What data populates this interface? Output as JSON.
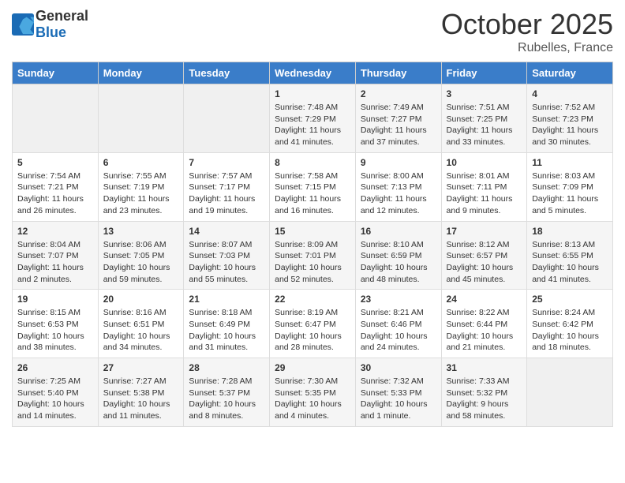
{
  "header": {
    "logo_general": "General",
    "logo_blue": "Blue",
    "month": "October 2025",
    "location": "Rubelles, France"
  },
  "days_of_week": [
    "Sunday",
    "Monday",
    "Tuesday",
    "Wednesday",
    "Thursday",
    "Friday",
    "Saturday"
  ],
  "weeks": [
    [
      {
        "day": "",
        "info": ""
      },
      {
        "day": "",
        "info": ""
      },
      {
        "day": "",
        "info": ""
      },
      {
        "day": "1",
        "info": "Sunrise: 7:48 AM\nSunset: 7:29 PM\nDaylight: 11 hours and 41 minutes."
      },
      {
        "day": "2",
        "info": "Sunrise: 7:49 AM\nSunset: 7:27 PM\nDaylight: 11 hours and 37 minutes."
      },
      {
        "day": "3",
        "info": "Sunrise: 7:51 AM\nSunset: 7:25 PM\nDaylight: 11 hours and 33 minutes."
      },
      {
        "day": "4",
        "info": "Sunrise: 7:52 AM\nSunset: 7:23 PM\nDaylight: 11 hours and 30 minutes."
      }
    ],
    [
      {
        "day": "5",
        "info": "Sunrise: 7:54 AM\nSunset: 7:21 PM\nDaylight: 11 hours and 26 minutes."
      },
      {
        "day": "6",
        "info": "Sunrise: 7:55 AM\nSunset: 7:19 PM\nDaylight: 11 hours and 23 minutes."
      },
      {
        "day": "7",
        "info": "Sunrise: 7:57 AM\nSunset: 7:17 PM\nDaylight: 11 hours and 19 minutes."
      },
      {
        "day": "8",
        "info": "Sunrise: 7:58 AM\nSunset: 7:15 PM\nDaylight: 11 hours and 16 minutes."
      },
      {
        "day": "9",
        "info": "Sunrise: 8:00 AM\nSunset: 7:13 PM\nDaylight: 11 hours and 12 minutes."
      },
      {
        "day": "10",
        "info": "Sunrise: 8:01 AM\nSunset: 7:11 PM\nDaylight: 11 hours and 9 minutes."
      },
      {
        "day": "11",
        "info": "Sunrise: 8:03 AM\nSunset: 7:09 PM\nDaylight: 11 hours and 5 minutes."
      }
    ],
    [
      {
        "day": "12",
        "info": "Sunrise: 8:04 AM\nSunset: 7:07 PM\nDaylight: 11 hours and 2 minutes."
      },
      {
        "day": "13",
        "info": "Sunrise: 8:06 AM\nSunset: 7:05 PM\nDaylight: 10 hours and 59 minutes."
      },
      {
        "day": "14",
        "info": "Sunrise: 8:07 AM\nSunset: 7:03 PM\nDaylight: 10 hours and 55 minutes."
      },
      {
        "day": "15",
        "info": "Sunrise: 8:09 AM\nSunset: 7:01 PM\nDaylight: 10 hours and 52 minutes."
      },
      {
        "day": "16",
        "info": "Sunrise: 8:10 AM\nSunset: 6:59 PM\nDaylight: 10 hours and 48 minutes."
      },
      {
        "day": "17",
        "info": "Sunrise: 8:12 AM\nSunset: 6:57 PM\nDaylight: 10 hours and 45 minutes."
      },
      {
        "day": "18",
        "info": "Sunrise: 8:13 AM\nSunset: 6:55 PM\nDaylight: 10 hours and 41 minutes."
      }
    ],
    [
      {
        "day": "19",
        "info": "Sunrise: 8:15 AM\nSunset: 6:53 PM\nDaylight: 10 hours and 38 minutes."
      },
      {
        "day": "20",
        "info": "Sunrise: 8:16 AM\nSunset: 6:51 PM\nDaylight: 10 hours and 34 minutes."
      },
      {
        "day": "21",
        "info": "Sunrise: 8:18 AM\nSunset: 6:49 PM\nDaylight: 10 hours and 31 minutes."
      },
      {
        "day": "22",
        "info": "Sunrise: 8:19 AM\nSunset: 6:47 PM\nDaylight: 10 hours and 28 minutes."
      },
      {
        "day": "23",
        "info": "Sunrise: 8:21 AM\nSunset: 6:46 PM\nDaylight: 10 hours and 24 minutes."
      },
      {
        "day": "24",
        "info": "Sunrise: 8:22 AM\nSunset: 6:44 PM\nDaylight: 10 hours and 21 minutes."
      },
      {
        "day": "25",
        "info": "Sunrise: 8:24 AM\nSunset: 6:42 PM\nDaylight: 10 hours and 18 minutes."
      }
    ],
    [
      {
        "day": "26",
        "info": "Sunrise: 7:25 AM\nSunset: 5:40 PM\nDaylight: 10 hours and 14 minutes."
      },
      {
        "day": "27",
        "info": "Sunrise: 7:27 AM\nSunset: 5:38 PM\nDaylight: 10 hours and 11 minutes."
      },
      {
        "day": "28",
        "info": "Sunrise: 7:28 AM\nSunset: 5:37 PM\nDaylight: 10 hours and 8 minutes."
      },
      {
        "day": "29",
        "info": "Sunrise: 7:30 AM\nSunset: 5:35 PM\nDaylight: 10 hours and 4 minutes."
      },
      {
        "day": "30",
        "info": "Sunrise: 7:32 AM\nSunset: 5:33 PM\nDaylight: 10 hours and 1 minute."
      },
      {
        "day": "31",
        "info": "Sunrise: 7:33 AM\nSunset: 5:32 PM\nDaylight: 9 hours and 58 minutes."
      },
      {
        "day": "",
        "info": ""
      }
    ]
  ]
}
